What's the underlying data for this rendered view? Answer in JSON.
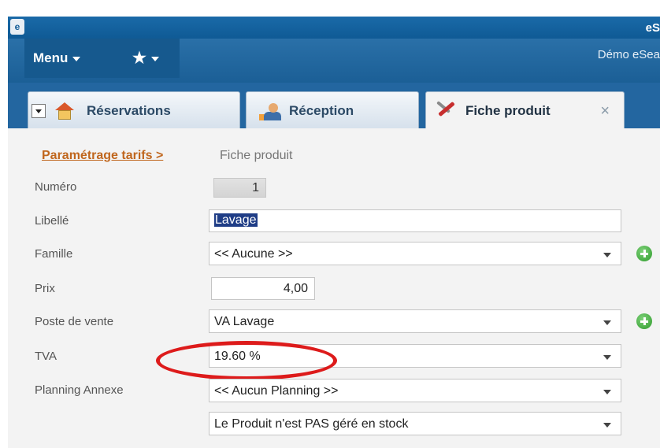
{
  "window": {
    "app_name": "eS"
  },
  "menubar": {
    "menu_label": "Menu",
    "favorites_icon": "star-icon",
    "demo_text": "Démo eSea"
  },
  "tabs": [
    {
      "label": "Réservations",
      "icon": "home-icon"
    },
    {
      "label": "Réception",
      "icon": "reception-icon"
    },
    {
      "label": "Fiche produit",
      "icon": "tools-icon",
      "active": true,
      "close": "×"
    }
  ],
  "breadcrumb": {
    "link": "Paramétrage tarifs >",
    "current": "Fiche produit"
  },
  "form": {
    "numero": {
      "label": "Numéro",
      "value": "1"
    },
    "libelle": {
      "label": "Libellé",
      "value": "Lavage"
    },
    "famille": {
      "label": "Famille",
      "value": "<< Aucune >>"
    },
    "prix": {
      "label": "Prix",
      "value": "4,00"
    },
    "poste": {
      "label": "Poste de vente",
      "value": "VA Lavage"
    },
    "tva": {
      "label": "TVA",
      "value": "19.60 %"
    },
    "planning": {
      "label": "Planning Annexe",
      "value": "<< Aucun Planning >>"
    },
    "stock": {
      "value": "Le Produit n'est PAS géré en stock"
    }
  },
  "colors": {
    "title_bar": "#0f5a95",
    "accent_link": "#c0661d",
    "highlight": "#dd1b1b"
  }
}
